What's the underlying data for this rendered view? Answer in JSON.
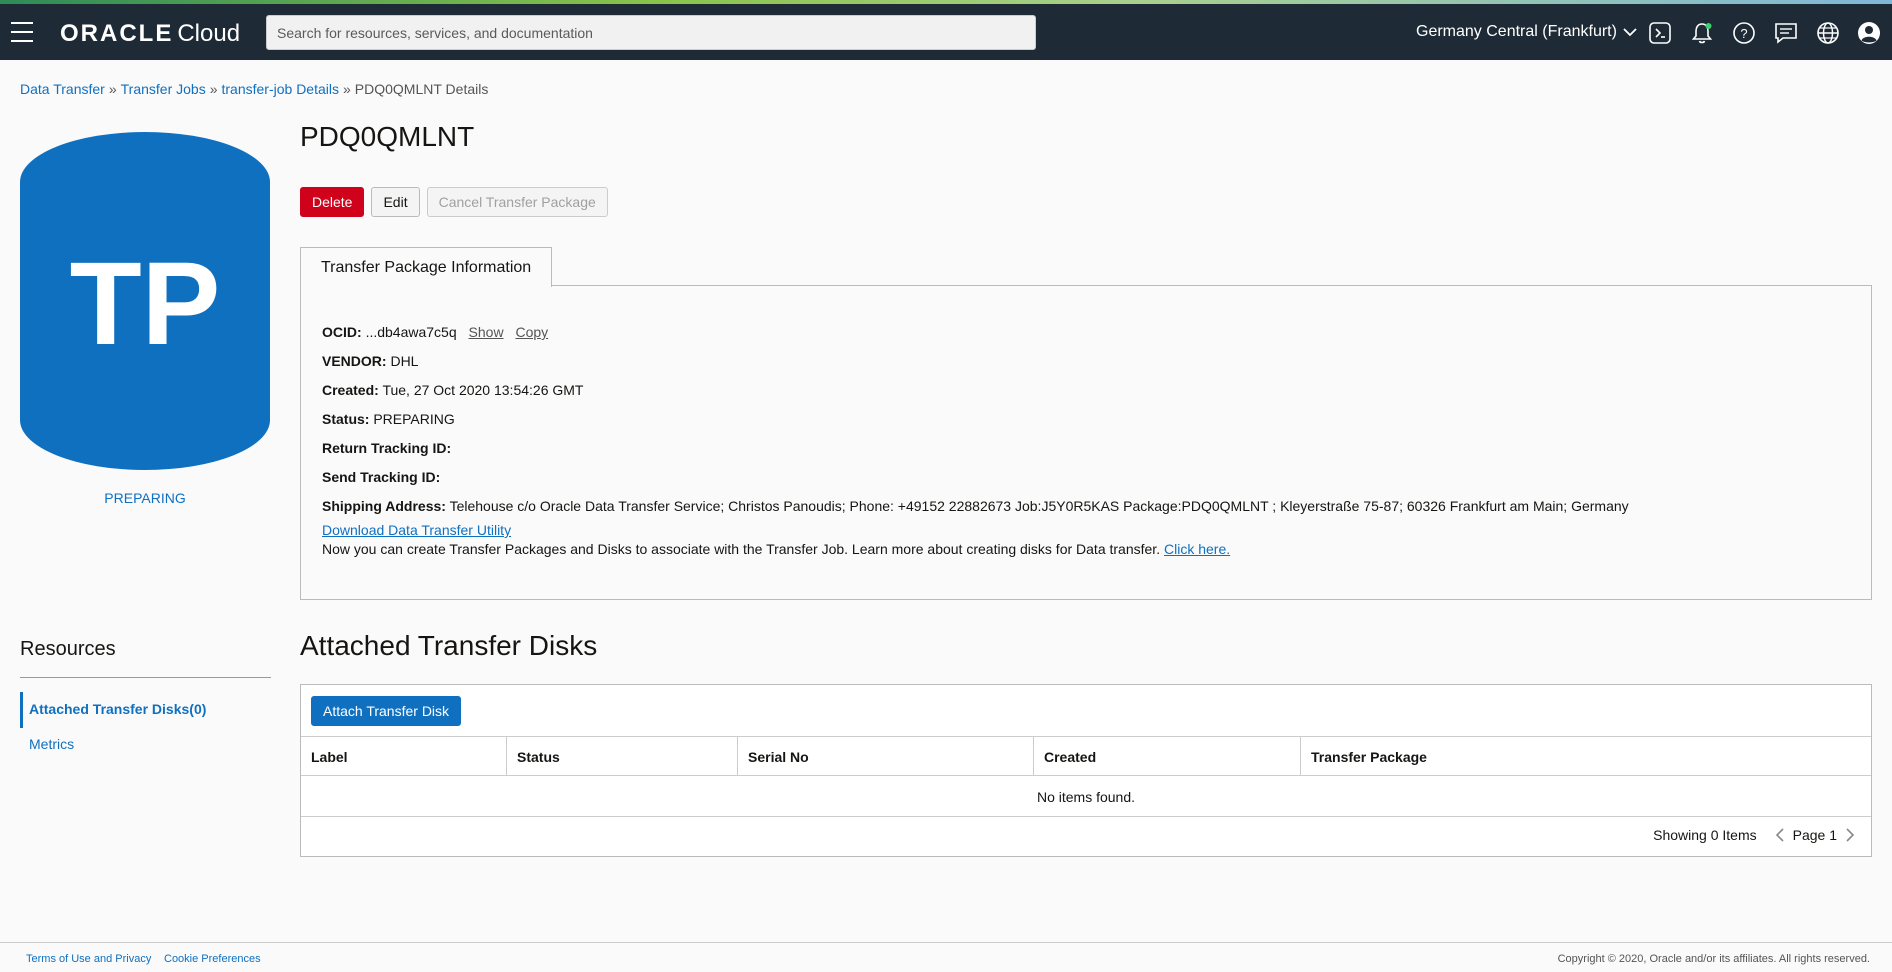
{
  "header": {
    "brand_main": "ORACLE",
    "brand_sub": "Cloud",
    "search_placeholder": "Search for resources, services, and documentation",
    "region": "Germany Central (Frankfurt)",
    "icons": [
      "cloud-shell-icon",
      "notifications-icon",
      "help-icon",
      "feedback-icon",
      "language-icon",
      "profile-icon"
    ]
  },
  "breadcrumb": {
    "items": [
      "Data Transfer",
      "Transfer Jobs",
      "transfer-job Details"
    ],
    "current": "PDQ0QMLNT Details",
    "separator": "»"
  },
  "badge": {
    "initials": "TP",
    "status": "PREPARING",
    "color": "#1070c0"
  },
  "page": {
    "title": "PDQ0QMLNT",
    "buttons": {
      "delete": "Delete",
      "edit": "Edit",
      "cancel": "Cancel Transfer Package"
    }
  },
  "info": {
    "tab_label": "Transfer Package Information",
    "ocid_label": "OCID:",
    "ocid_value": "...db4awa7c5q",
    "ocid_show": "Show",
    "ocid_copy": "Copy",
    "vendor_label": "VENDOR:",
    "vendor_value": "DHL",
    "created_label": "Created:",
    "created_value": "Tue, 27 Oct 2020 13:54:26 GMT",
    "status_label": "Status:",
    "status_value": "PREPARING",
    "return_label": "Return Tracking ID:",
    "send_label": "Send Tracking ID:",
    "shipping_label": "Shipping Address:",
    "shipping_value": "Telehouse c/o Oracle Data Transfer Service; Christos Panoudis; Phone: +49152 22882673 Job:J5Y0R5KAS Package:PDQ0QMLNT ; Kleyerstraße 75-87; 60326 Frankfurt am Main; Germany",
    "download_link": "Download Data Transfer Utility",
    "note_text": "Now you can create Transfer Packages and Disks to associate with the Transfer Job. Learn more about creating disks for Data transfer.",
    "note_link": "Click here."
  },
  "resources": {
    "title": "Resources",
    "items": [
      "Attached Transfer Disks(0)",
      "Metrics"
    ]
  },
  "disks": {
    "title": "Attached Transfer Disks",
    "attach_button": "Attach Transfer Disk",
    "columns": [
      "Label",
      "Status",
      "Serial No",
      "Created",
      "Transfer Package"
    ],
    "empty_text": "No items found.",
    "showing": "Showing 0 Items",
    "page": "Page 1"
  },
  "footer": {
    "terms": "Terms of Use and Privacy",
    "cookies": "Cookie Preferences",
    "copyright": "Copyright © 2020, Oracle and/or its affiliates. All rights reserved."
  }
}
